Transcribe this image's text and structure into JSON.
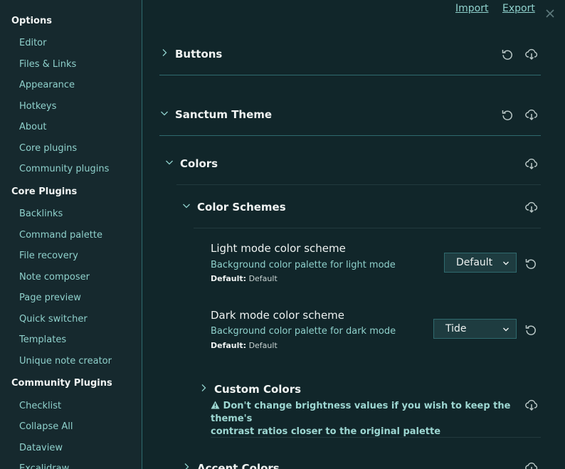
{
  "sidebar": {
    "groups": [
      {
        "title": "Options",
        "items": [
          "Editor",
          "Files & Links",
          "Appearance",
          "Hotkeys",
          "About",
          "Core plugins",
          "Community plugins"
        ]
      },
      {
        "title": "Core Plugins",
        "items": [
          "Backlinks",
          "Command palette",
          "File recovery",
          "Note composer",
          "Page preview",
          "Quick switcher",
          "Templates",
          "Unique note creator"
        ]
      },
      {
        "title": "Community Plugins",
        "items": [
          "Checklist",
          "Collapse All",
          "Dataview",
          "Excalidraw"
        ]
      }
    ]
  },
  "topbar": {
    "import_label": "Import",
    "export_label": "Export"
  },
  "sections": {
    "buttons": "Buttons",
    "sanctum_theme": "Sanctum Theme",
    "colors": "Colors",
    "color_schemes": "Color Schemes",
    "custom_colors": "Custom Colors",
    "accent_colors": "Accent Colors"
  },
  "settings": {
    "light": {
      "name": "Light mode color scheme",
      "desc": "Background color palette for light mode",
      "default_label": "Default:",
      "default_value": "Default",
      "selected": "Default"
    },
    "dark": {
      "name": "Dark mode color scheme",
      "desc": "Background color palette for dark mode",
      "default_label": "Default:",
      "default_value": "Default",
      "selected": "Tide"
    }
  },
  "custom_colors_warning": {
    "icon": "warning-triangle-icon",
    "line1": "Don't change brightness values if you wish to keep the theme's",
    "line2": "contrast ratios closer to the original palette"
  },
  "colors": {
    "accent": "#8fd1cc",
    "background": "#11262a",
    "sidebar": "#16292e",
    "border": "#2f6a6e"
  }
}
